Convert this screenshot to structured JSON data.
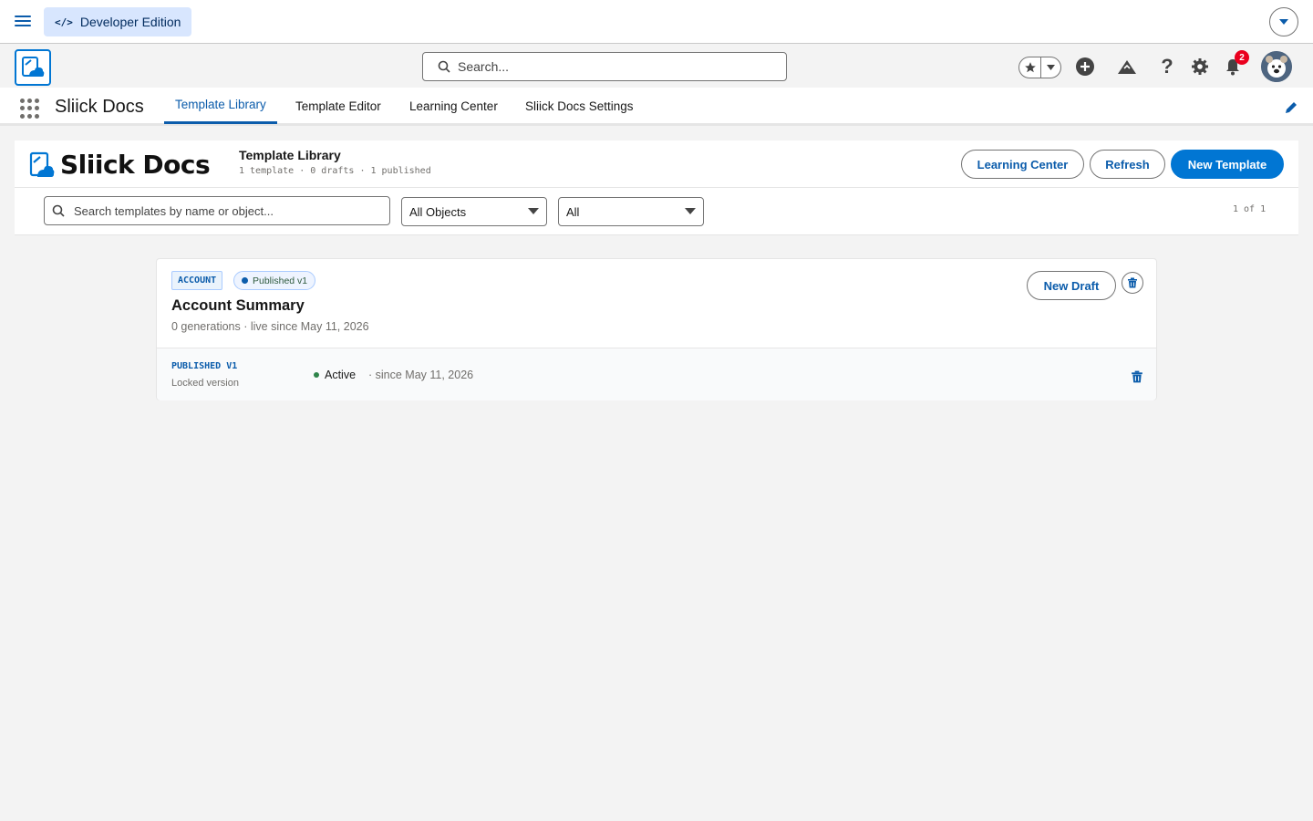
{
  "topbar": {
    "edition_label": "Developer Edition",
    "edition_icon": "code-icon"
  },
  "header": {
    "search_placeholder": "Search...",
    "notification_count": "2"
  },
  "nav": {
    "app_name": "Sliick Docs",
    "tabs": [
      {
        "label": "Template Library",
        "active": true
      },
      {
        "label": "Template Editor",
        "active": false
      },
      {
        "label": "Learning Center",
        "active": false
      },
      {
        "label": "Sliick Docs Settings",
        "active": false
      }
    ]
  },
  "page": {
    "brand_word": "Sliick Docs",
    "title": "Template Library",
    "subtitle": "1 template · 0 drafts · 1 published",
    "buttons": {
      "learning_center": "Learning Center",
      "refresh": "Refresh",
      "new_template": "New Template"
    }
  },
  "filters": {
    "search_placeholder": "Search templates by name or object...",
    "object_filter": "All Objects",
    "status_filter": "All",
    "pager": "1 of 1"
  },
  "templates": [
    {
      "object_badge": "ACCOUNT",
      "status": "Published v1",
      "name": "Account Summary",
      "meta": "0 generations · live since May 11, 2026",
      "new_draft_label": "New Draft",
      "versions": [
        {
          "label": "PUBLISHED V1",
          "sub": "Locked version",
          "state": "Active",
          "since": "· since May 11, 2026"
        }
      ]
    }
  ],
  "colors": {
    "brand": "#0176d3",
    "link": "#0b5cab",
    "success": "#2e844a",
    "alert": "#ea001e"
  }
}
